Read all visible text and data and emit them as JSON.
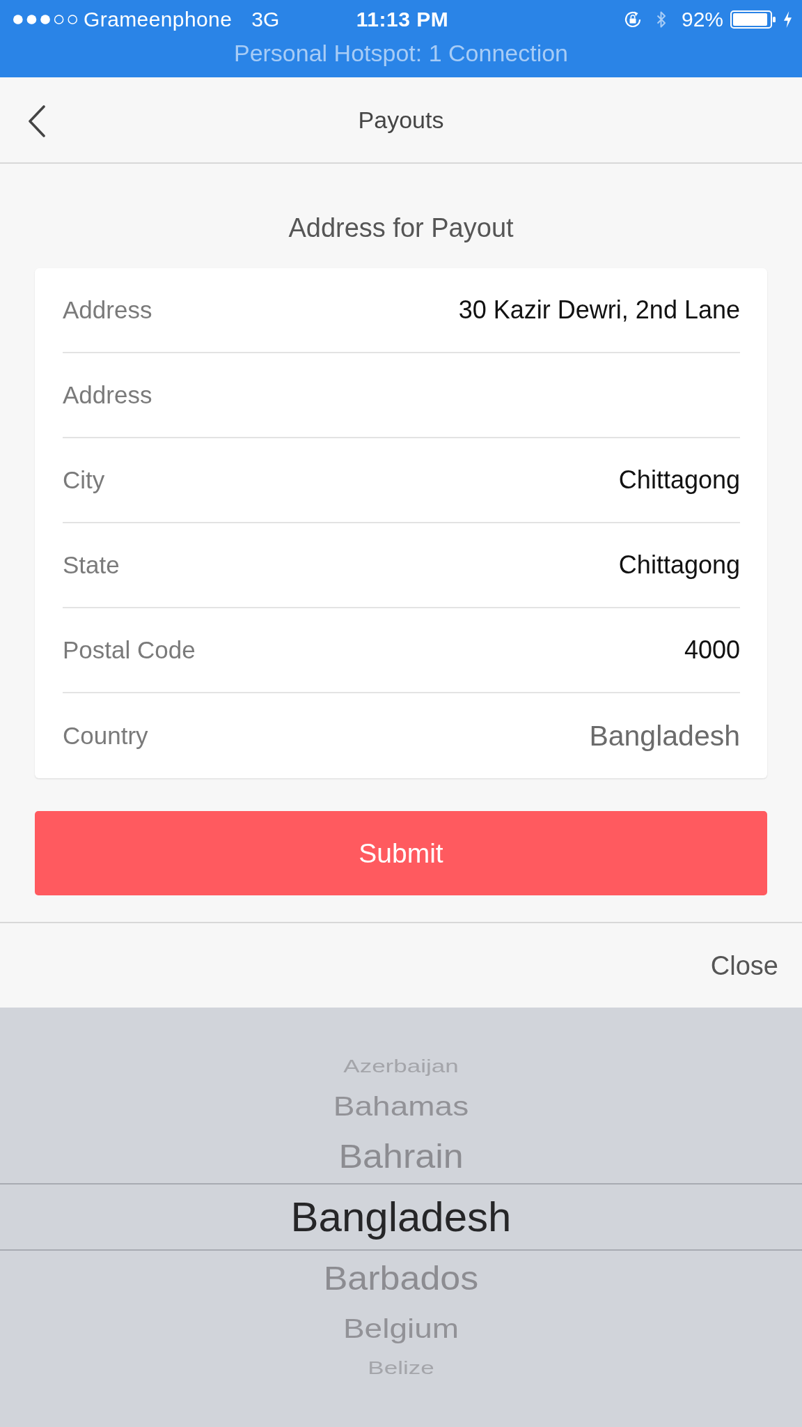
{
  "status_bar": {
    "carrier": "Grameenphone",
    "network": "3G",
    "time": "11:13 PM",
    "battery": "92%",
    "hotspot": "Personal Hotspot: 1 Connection"
  },
  "nav": {
    "title": "Payouts"
  },
  "form": {
    "heading": "Address for Payout",
    "fields": [
      {
        "kind": "text",
        "label": "Address",
        "value": "30 Kazir Dewri, 2nd Lane"
      },
      {
        "kind": "text",
        "label": "Address"
      },
      {
        "kind": "text",
        "label": "City",
        "value": "Chittagong"
      },
      {
        "kind": "text",
        "label": "State",
        "value": "Chittagong"
      },
      {
        "kind": "text",
        "label": "Postal Code",
        "value": "4000"
      },
      {
        "kind": "select",
        "label": "Country",
        "value": "Bangladesh"
      }
    ],
    "submit": "Submit"
  },
  "picker_toolbar": {
    "close": "Close"
  },
  "picker": {
    "items": [
      {
        "label": "Azerbaijan",
        "selected": false
      },
      {
        "label": "Bahamas",
        "selected": false
      },
      {
        "label": "Bahrain",
        "selected": false
      },
      {
        "label": "Bangladesh",
        "selected": true
      },
      {
        "label": "Barbados",
        "selected": false
      },
      {
        "label": "Belgium",
        "selected": false
      },
      {
        "label": "Belize",
        "selected": false
      }
    ]
  }
}
